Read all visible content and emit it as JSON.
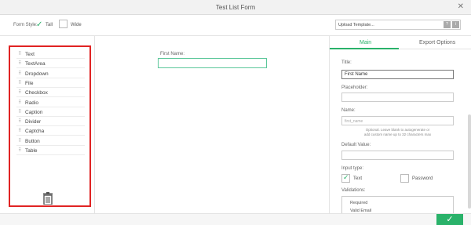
{
  "window": {
    "title": "Test List Form",
    "close_glyph": "✕"
  },
  "toolbar": {
    "form_style_label": "Form Style:",
    "tall_label": "Tall",
    "tall_selected": true,
    "wide_label": "Wide",
    "wide_selected": false,
    "upload_template_placeholder": "Upload Template...",
    "help_button": "?",
    "info_button": "i"
  },
  "palette": {
    "items": [
      {
        "label": "Text"
      },
      {
        "label": "TextArea"
      },
      {
        "label": "Dropdown"
      },
      {
        "label": "File"
      },
      {
        "label": "Checkbox"
      },
      {
        "label": "Radio"
      },
      {
        "label": "Caption"
      },
      {
        "label": "Divider"
      },
      {
        "label": "Captcha"
      },
      {
        "label": "Button"
      },
      {
        "label": "Table"
      }
    ],
    "trash_icon": "trash-icon"
  },
  "canvas": {
    "first_name_label": "First Name:",
    "first_name_value": ""
  },
  "properties": {
    "tabs": [
      {
        "label": "Main",
        "active": true
      },
      {
        "label": "Export Options",
        "active": false
      }
    ],
    "title_label": "Title:",
    "title_value": "First Name",
    "placeholder_label": "Placeholder:",
    "placeholder_value": "",
    "name_label": "Name:",
    "name_placeholder": "first_name",
    "name_hint_line1": "Optional. Leave blank to autogenerate or",
    "name_hint_line2": "add custom name up to 32 characters max",
    "default_value_label": "Default Value:",
    "default_value": "",
    "input_type_label": "Input type:",
    "input_type_text": "Text",
    "input_type_text_selected": true,
    "input_type_password": "Password",
    "input_type_password_selected": false,
    "validations_label": "Validations:",
    "validations": [
      "Required",
      "Valid Email"
    ]
  },
  "footer": {
    "confirm_glyph": "✓"
  },
  "colors": {
    "accent": "#2ab26a",
    "highlight_border": "#e02323"
  }
}
